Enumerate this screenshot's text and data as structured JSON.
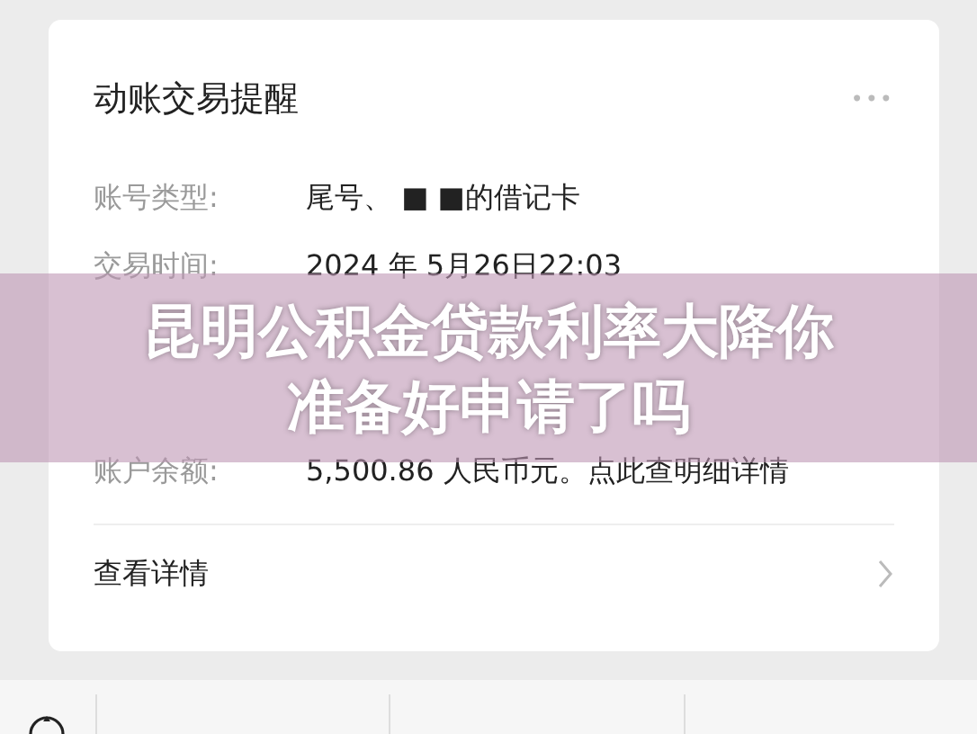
{
  "card": {
    "title": "动账交易提醒",
    "more": "•••",
    "rows": [
      {
        "kind": "field",
        "label": "账号类型:",
        "value": "尾号、 ■ ■的借记卡"
      },
      {
        "kind": "field",
        "label": "交易时间:",
        "value": "2024 年 5月26日22:03"
      },
      {
        "kind": "covered"
      },
      {
        "kind": "covered"
      },
      {
        "kind": "field",
        "label": "账户余额:",
        "value": "5,500.86 人民币元。点此查明细详情"
      }
    ],
    "link": "查看详情"
  },
  "banner": {
    "title": "昆明公积金贷款利率大降你准备好申请了吗"
  }
}
